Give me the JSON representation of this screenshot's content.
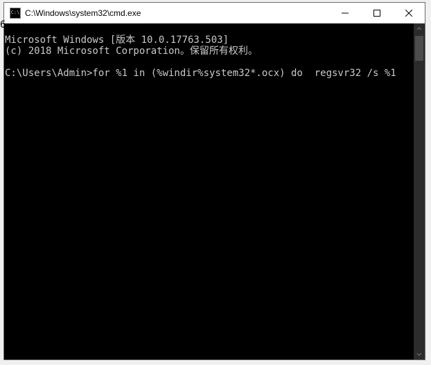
{
  "titlebar": {
    "icon_glyph": "C:\\",
    "title": "C:\\Windows\\system32\\cmd.exe"
  },
  "stray_char": "6",
  "console": {
    "line1": "Microsoft Windows [版本 10.0.17763.503]",
    "line2": "(c) 2018 Microsoft Corporation。保留所有权利。",
    "blank": "",
    "prompt_line": "C:\\Users\\Admin>for %1 in (%windir%system32*.ocx) do  regsvr32 /s %1"
  }
}
